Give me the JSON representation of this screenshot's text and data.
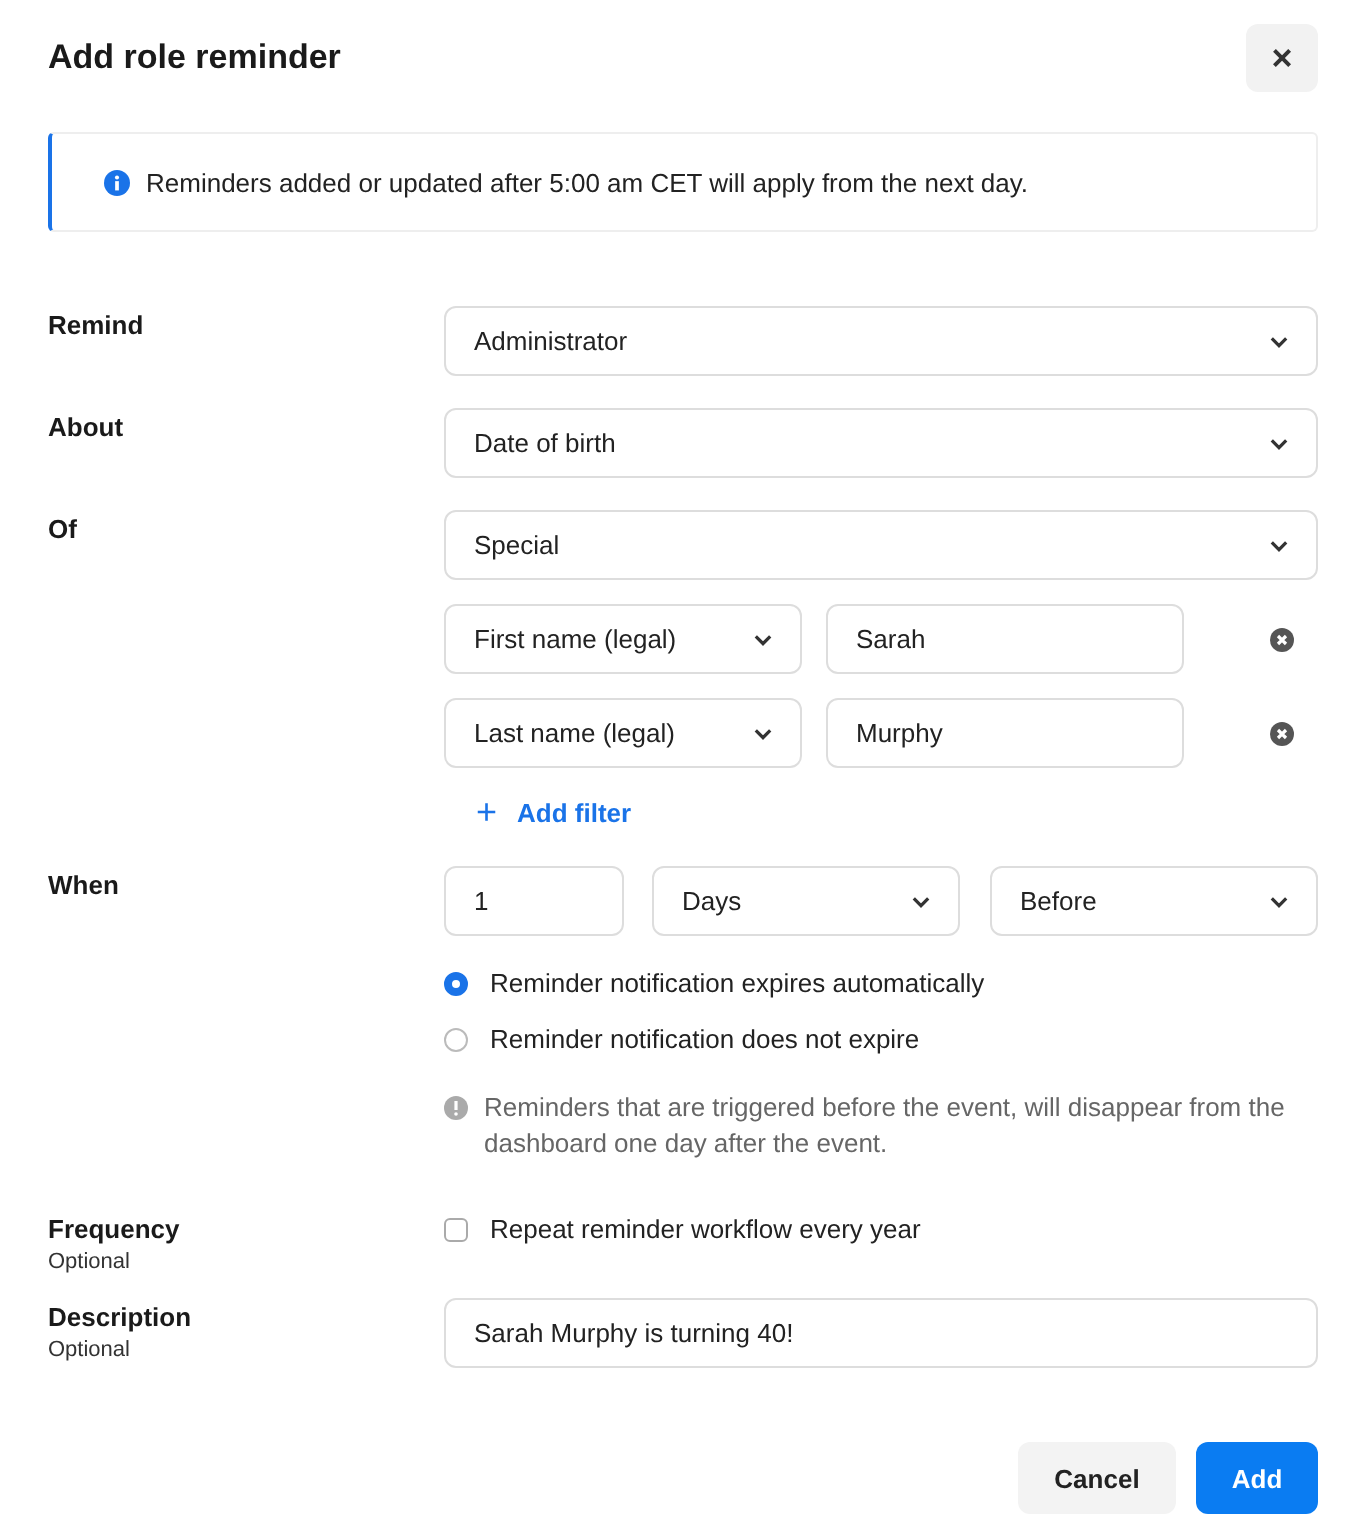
{
  "dialog": {
    "title": "Add role reminder",
    "close": "×"
  },
  "banner": {
    "text": "Reminders added or updated after 5:00 am CET will apply from the next day."
  },
  "remind": {
    "label": "Remind",
    "value": "Administrator"
  },
  "about": {
    "label": "About",
    "value": "Date of birth"
  },
  "of": {
    "label": "Of",
    "value": "Special",
    "filters": [
      {
        "field": "First name (legal)",
        "value": "Sarah"
      },
      {
        "field": "Last name (legal)",
        "value": "Murphy"
      }
    ],
    "add_filter": {
      "icon": "+",
      "label": "Add filter"
    }
  },
  "when": {
    "label": "When",
    "amount": "1",
    "unit": "Days",
    "relation": "Before",
    "options": [
      {
        "label": "Reminder notification expires automatically",
        "selected": true
      },
      {
        "label": "Reminder notification does not expire",
        "selected": false
      }
    ],
    "note": "Reminders that are triggered before the event, will disappear from the dashboard one day after the event."
  },
  "frequency": {
    "label": "Frequency",
    "hint": "Optional",
    "checkbox": {
      "label": "Repeat reminder workflow every year",
      "checked": false
    }
  },
  "description": {
    "label": "Description",
    "hint": "Optional",
    "value": "Sarah Murphy is turning 40!"
  },
  "buttons": [
    {
      "label": "Cancel",
      "kind": "secondary"
    },
    {
      "label": "Add",
      "kind": "primary"
    }
  ]
}
